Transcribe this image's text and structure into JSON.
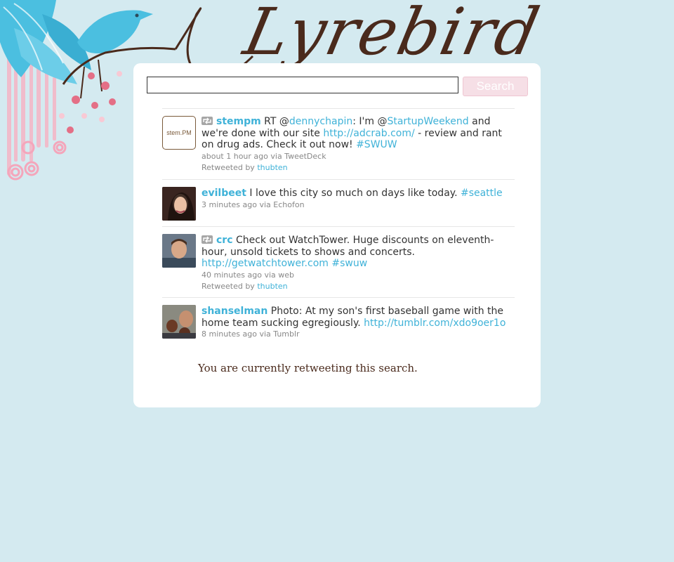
{
  "app": {
    "logo_text": "Lyrebird"
  },
  "search": {
    "placeholder": "",
    "value": "",
    "button_label": "Search"
  },
  "tweets": [
    {
      "avatar_text": "stem.PM",
      "retweet_icon": "retweet-icon",
      "username": "stempm",
      "parts": [
        "RT @",
        "dennychapin",
        ": I'm @",
        "StartupWeekend",
        " and we're done with our site ",
        "http://adcrab.com/",
        " - review and rant on drug ads. Check it out now! ",
        "#SWUW"
      ],
      "meta": "about 1 hour ago via TweetDeck",
      "retweeted_by_label": "Retweeted by",
      "retweeted_by": "thubten"
    },
    {
      "username": "evilbeet",
      "parts": [
        " I love this city so much on days like today. ",
        "#seattle"
      ],
      "meta": "3 minutes ago via Echofon"
    },
    {
      "retweet_icon": "retweet-icon",
      "username": "crc",
      "parts": [
        " Check out WatchTower. Huge discounts on eleventh-hour, unsold tickets to shows and concerts. ",
        "http://getwatchtower.com",
        " ",
        "#swuw"
      ],
      "meta": "40 minutes ago via web",
      "retweeted_by_label": "Retweeted by",
      "retweeted_by": "thubten"
    },
    {
      "username": "shanselman",
      "parts": [
        " Photo: At my son's first baseball game with the home team sucking egregiously. ",
        "http://tumblr.com/xdo9oer1o"
      ],
      "meta": "8 minutes ago via Tumblr"
    }
  ],
  "footer": {
    "message": "You are currently retweeting this search."
  },
  "colors": {
    "background": "#d4eaf0",
    "link": "#3fb2d8",
    "logo": "#4a2a1c",
    "button": "#f6dfe6"
  }
}
